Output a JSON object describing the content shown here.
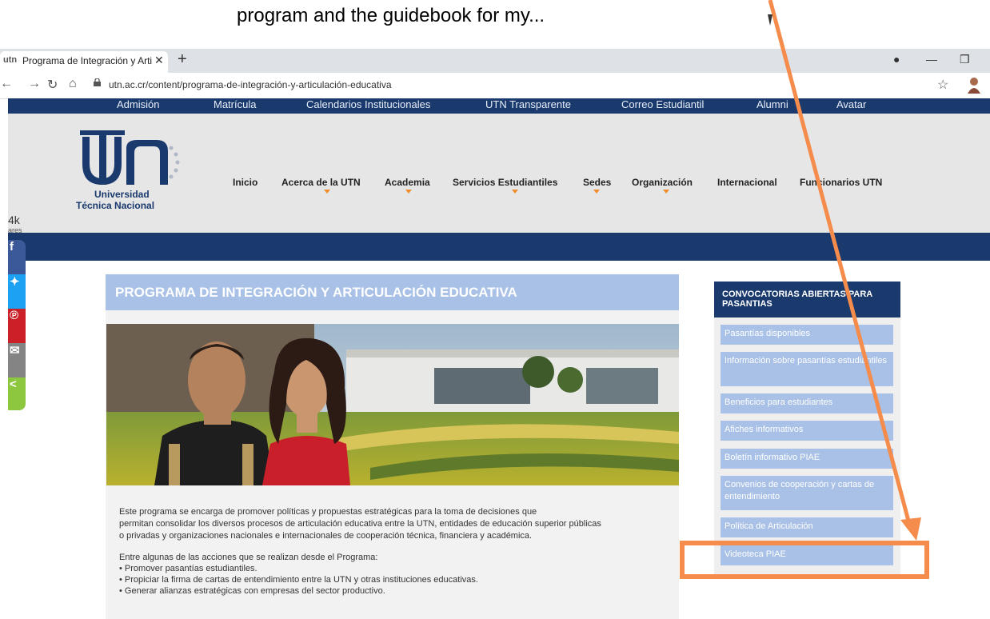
{
  "caption": "program and the guidebook for my...",
  "browser": {
    "tab_title": "Programa de Integración y Articu",
    "favicon_text": "utn",
    "new_tab": "+",
    "url": "utn.ac.cr/content/programa-de-integración-y-articulación-educativa"
  },
  "topnav": [
    "Admisión",
    "Matrícula",
    "Calendarios Institucionales",
    "UTN Transparente",
    "Correo Estudiantil",
    "Alumni",
    "Avatar"
  ],
  "logo": {
    "line1": "Universidad",
    "line2": "Técnica Nacional"
  },
  "mainnav": [
    "Inicio",
    "Acerca de la UTN",
    "Academia",
    "Servicios Estudiantiles",
    "Sedes",
    "Organización",
    "Internacional",
    "Funcionarios UTN"
  ],
  "share": {
    "count": "4k",
    "label": "ares"
  },
  "page": {
    "title": "PROGRAMA DE INTEGRACIÓN Y ARTICULACIÓN EDUCATIVA",
    "para1": [
      "Este programa se encarga de promover políticas y propuestas estratégicas para la toma de decisiones que",
      "permitan consolidar los diversos procesos de articulación educativa entre la UTN, entidades de educación superior públicas",
      "o privadas y organizaciones nacionales e internacionales de cooperación técnica, financiera y académica."
    ],
    "para2_intro": "Entre algunas de las acciones que se realizan desde el Programa:",
    "bullets": [
      "• Promover pasantías estudiantiles.",
      "• Propiciar la firma de cartas de entendimiento entre la UTN y otras instituciones educativas.",
      "• Generar alianzas estratégicas con empresas del sector productivo."
    ]
  },
  "sidebar": {
    "heading": "CONVOCATORIAS ABIERTAS PARA PASANTIAS",
    "items": [
      "Pasantías disponibles",
      "Información sobre pasantías estudiantiles",
      "Beneficios para estudiantes",
      "Afiches informativos",
      "Boletín informativo PIAE",
      "Convenios de cooperación y cartas de entendimiento",
      "Política de Articulación",
      "Videoteca PIAE"
    ]
  },
  "colors": {
    "navy": "#1a3a6e",
    "light_blue": "#a9c1e6",
    "accent_orange": "#f08c2a",
    "annotation": "#f58c4c"
  }
}
